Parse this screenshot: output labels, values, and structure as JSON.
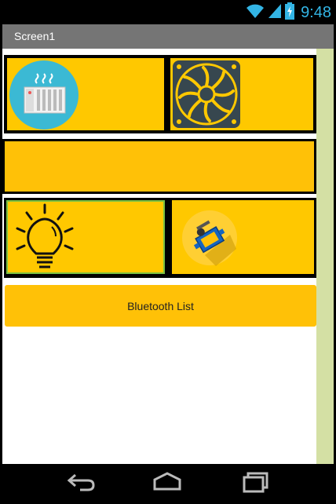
{
  "status_bar": {
    "time": "9:48",
    "icons": [
      "wifi-icon",
      "signal-icon",
      "battery-icon"
    ]
  },
  "title_bar": {
    "title": "Screen1"
  },
  "grid": {
    "row1": [
      "heater-icon",
      "fan-icon"
    ],
    "row3": [
      "bulb-icon",
      "servo-icon"
    ]
  },
  "bluetooth_button": {
    "label": "Bluetooth List"
  },
  "nav": [
    "back-icon",
    "home-icon",
    "recents-icon"
  ],
  "colors": {
    "accent": "#ffc800",
    "button": "#ffc107",
    "scrollbar": "#d4e0a4",
    "titlebar": "#757575",
    "time": "#33b5e5"
  }
}
